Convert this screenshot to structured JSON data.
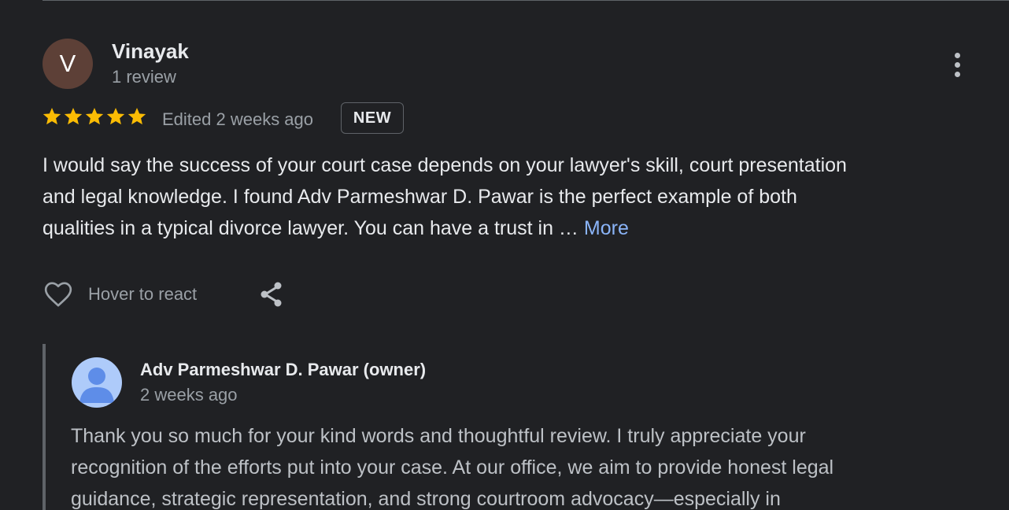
{
  "review": {
    "avatar_letter": "V",
    "avatar_color": "#5d4037",
    "name": "Vinayak",
    "review_count": "1 review",
    "rating": 5,
    "rating_max": 5,
    "star_color": "#fbbc04",
    "edited_time": "Edited 2 weeks ago",
    "badge": "NEW",
    "text_lines": [
      "I would say the success of your court case depends on your lawyer's skill, court presentation",
      "and legal knowledge. I found Adv Parmeshwar D. Pawar is the perfect example of both",
      "qualities in a typical divorce lawyer. You can have a trust in …"
    ],
    "more_label": "More",
    "link_color": "#8ab4f8",
    "react_label": "Hover to react",
    "icons": {
      "menu": "more-vert-icon",
      "like": "heart-outline-icon",
      "share": "share-icon"
    }
  },
  "owner_reply": {
    "name": "Adv Parmeshwar D. Pawar (owner)",
    "time": "2 weeks ago",
    "avatar_icon": "default-user-avatar-icon",
    "text_lines": [
      "Thank you so much for your kind words and thoughtful review. I truly appreciate your",
      "recognition of the efforts put into your case. At our office, we aim to provide honest legal",
      "guidance, strategic representation, and strong courtroom advocacy—especially in"
    ]
  }
}
